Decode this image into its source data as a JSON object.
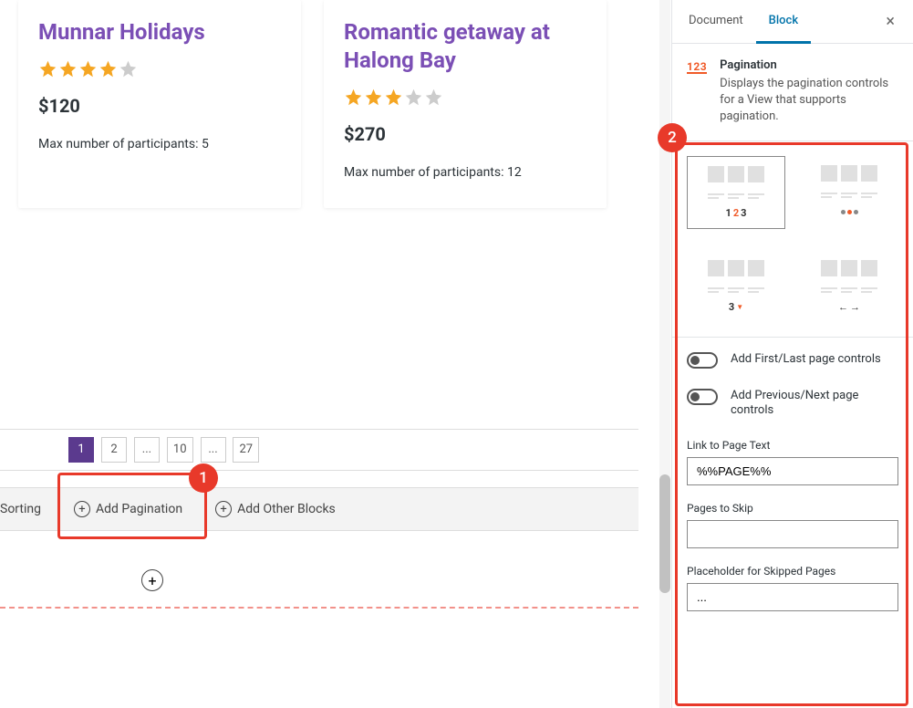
{
  "cards": {
    "card1": {
      "title": "Munnar Holidays",
      "rating": 4,
      "price": "$120",
      "meta": "Max number of participants: 5"
    },
    "card2": {
      "title": "Romantic getaway at Halong Bay",
      "rating": 3,
      "price": "$270",
      "meta": "Max number of participants: 12"
    }
  },
  "pagination": {
    "p1": "1",
    "p2": "2",
    "p3": "...",
    "p4": "10",
    "p5": "...",
    "p6": "27"
  },
  "toolbar": {
    "sorting": "Sorting",
    "add_pagination": "Add Pagination",
    "add_other": "Add Other Blocks"
  },
  "sidebar": {
    "tabs": {
      "document": "Document",
      "block": "Block"
    },
    "block_header": {
      "icon_text": "123",
      "title": "Pagination",
      "desc": "Displays the pagination controls for a View that supports pagination."
    },
    "styles": {
      "numbers": {
        "n1": "1",
        "n2": "2",
        "n3": "3"
      },
      "dropdown_num": "3"
    },
    "settings": {
      "first_last": "Add First/Last page controls",
      "prev_next": "Add Previous/Next page controls",
      "link_text_label": "Link to Page Text",
      "link_text_value": "%%PAGE%%",
      "pages_skip_label": "Pages to Skip",
      "pages_skip_value": "",
      "placeholder_label": "Placeholder for Skipped Pages",
      "placeholder_value": "..."
    }
  },
  "annotations": {
    "one": "1",
    "two": "2"
  }
}
